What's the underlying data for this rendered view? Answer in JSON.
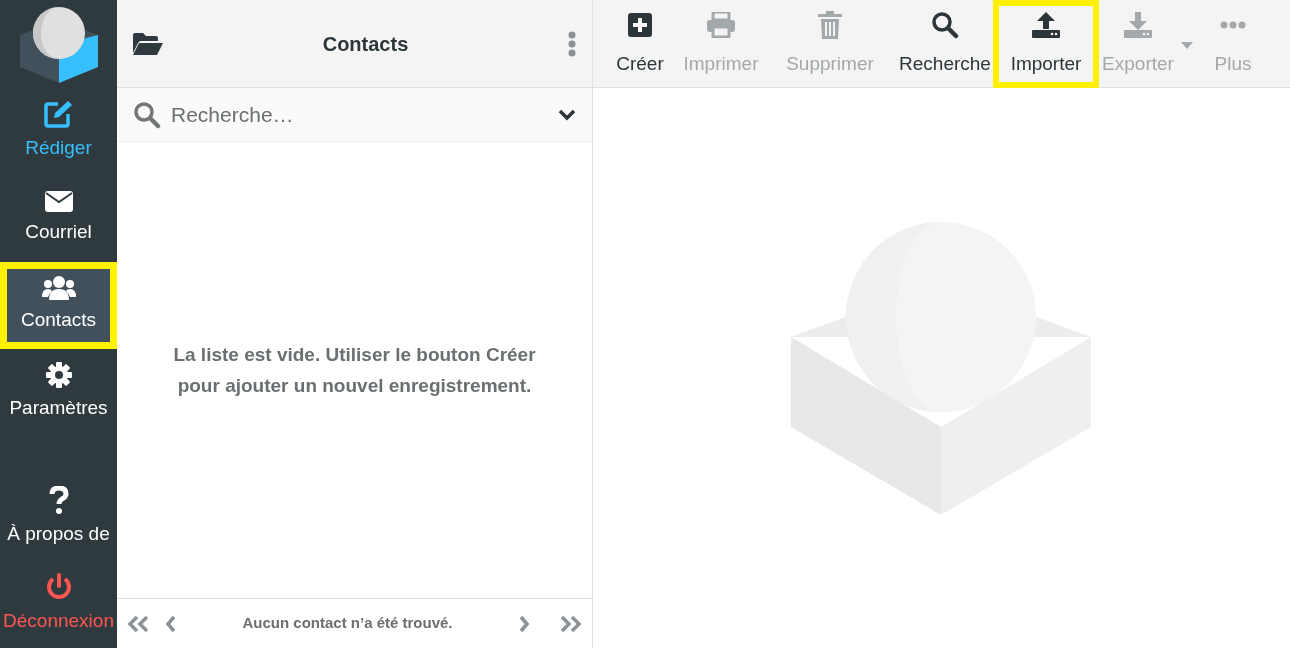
{
  "nav": [
    {
      "label": "Rédiger",
      "kind": "compose",
      "selected": false,
      "highlighted": false
    },
    {
      "label": "Courriel",
      "kind": "normal",
      "selected": false,
      "highlighted": false
    },
    {
      "label": "Contacts",
      "kind": "normal",
      "selected": true,
      "highlighted": true
    },
    {
      "label": "Paramètres",
      "kind": "normal",
      "selected": false,
      "highlighted": false
    },
    {
      "label": "À propos de",
      "kind": "normal",
      "selected": false,
      "highlighted": false
    },
    {
      "label": "Déconnexion",
      "kind": "logout",
      "selected": false,
      "highlighted": false
    }
  ],
  "list_panel": {
    "title": "Contacts",
    "search": {
      "placeholder": "Recherche…"
    },
    "empty_message": "La liste est vide. Utiliser le bouton Créer pour ajouter un nouvel enregistrement.",
    "footer": "Aucun contact n’a été trouvé."
  },
  "toolbar": [
    {
      "label": "Créer",
      "disabled": false,
      "highlighted": false
    },
    {
      "label": "Imprimer",
      "disabled": true,
      "highlighted": false
    },
    {
      "label": "Supprimer",
      "disabled": true,
      "highlighted": false
    },
    {
      "label": "Recherche",
      "disabled": false,
      "highlighted": false
    },
    {
      "label": "Importer",
      "disabled": false,
      "highlighted": true
    },
    {
      "label": "Exporter",
      "disabled": true,
      "highlighted": false,
      "dropdown": true
    },
    {
      "label": "Plus",
      "disabled": true,
      "highlighted": false
    }
  ]
}
